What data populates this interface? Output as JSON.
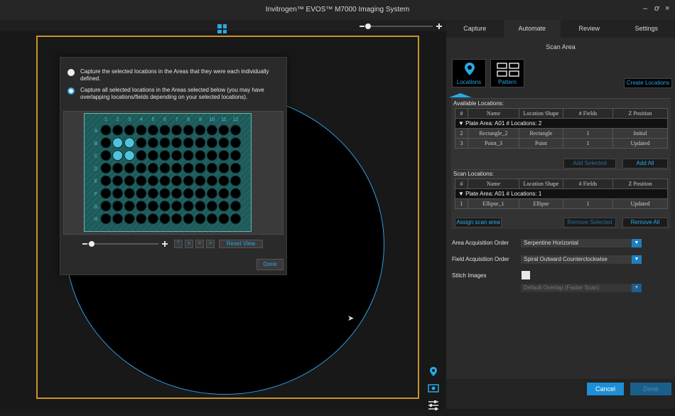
{
  "window": {
    "title": "Invitrogen™ EVOS™ M7000 Imaging System",
    "minimize": "–",
    "maximize": "ơ",
    "close": "×"
  },
  "popup": {
    "option1": "Capture the selected locations in the Areas that they were each individually defined.",
    "option2": "Capture all selected locations in the Areas selected below (you may have overlapping locations/fields depending on your selected locations).",
    "columns": [
      "1",
      "2",
      "3",
      "4",
      "5",
      "6",
      "7",
      "8",
      "9",
      "10",
      "11",
      "12"
    ],
    "rows": [
      "A",
      "B",
      "C",
      "D",
      "E",
      "F",
      "G",
      "H"
    ],
    "selected_wells": [
      "B2",
      "B3",
      "C2",
      "C3"
    ],
    "nav": [
      "^",
      "v",
      "<",
      ">"
    ],
    "reset_view": "Reset View",
    "done": "Done"
  },
  "tabs": [
    "Capture",
    "Automate",
    "Review",
    "Settings"
  ],
  "active_tab": "Automate",
  "section_title": "Scan Area",
  "modes": {
    "locations": "Locations",
    "pattern": "Pattern"
  },
  "create_locations": "Create Locations",
  "available": {
    "title": "Available Locations:",
    "headers": [
      "#",
      "Name",
      "Location Shape",
      "# Fields",
      "Z Position"
    ],
    "group": "Plate  Area: A01   # Locations: 2",
    "rows": [
      [
        "2",
        "Rectangle_2",
        "Rectangle",
        "1",
        "Initial"
      ],
      [
        "3",
        "Point_3",
        "Point",
        "1",
        "Updated"
      ]
    ],
    "add_selected": "Add Selected",
    "add_all": "Add All"
  },
  "scan": {
    "title": "Scan Locations:",
    "headers": [
      "#",
      "Name",
      "Location Shape",
      "# Fields",
      "Z Position"
    ],
    "group": "Plate  Area: A01   # Locations: 1",
    "rows": [
      [
        "1",
        "Ellipse_1",
        "Ellipse",
        "1",
        "Updated"
      ]
    ],
    "assign": "Assign scan area",
    "remove_selected": "Remove Selected",
    "remove_all": "Remove All"
  },
  "settings": {
    "area_label": "Area Acquisition Order",
    "area_value": "Serpentine Horizontal",
    "field_label": "Field Acquisition Order",
    "field_value": "Spiral Outward Counterclockwise",
    "stitch_label": "Stitch Images",
    "overlap_value": "Default Overlap (Faster Scan)"
  },
  "footer": {
    "cancel": "Cancel",
    "done": "Done"
  },
  "colors": {
    "accent": "#29a9e6",
    "border": "#c8922a",
    "well_selected": "#4fc3dd"
  }
}
